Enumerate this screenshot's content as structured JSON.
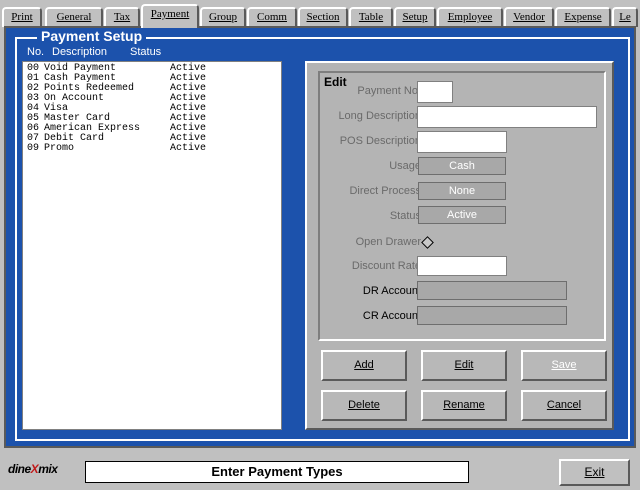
{
  "tabs": [
    {
      "label": "Print"
    },
    {
      "label": "General"
    },
    {
      "label": "Tax"
    },
    {
      "label": "Payment"
    },
    {
      "label": "Group"
    },
    {
      "label": "Comm"
    },
    {
      "label": "Section"
    },
    {
      "label": "Table"
    },
    {
      "label": "Setup"
    },
    {
      "label": "Employee"
    },
    {
      "label": "Vendor"
    },
    {
      "label": "Expense"
    },
    {
      "label": "Le"
    }
  ],
  "panel": {
    "title": "Payment Setup",
    "columns": {
      "no": "No.",
      "description": "Description",
      "status": "Status"
    }
  },
  "list": [
    {
      "no": "00",
      "description": "Void Payment",
      "status": "Active"
    },
    {
      "no": "01",
      "description": "Cash Payment",
      "status": "Active"
    },
    {
      "no": "02",
      "description": "Points Redeemed",
      "status": "Active"
    },
    {
      "no": "03",
      "description": "On Account",
      "status": "Active"
    },
    {
      "no": "04",
      "description": "Visa",
      "status": "Active"
    },
    {
      "no": "05",
      "description": "Master Card",
      "status": "Active"
    },
    {
      "no": "06",
      "description": "American Express",
      "status": "Active"
    },
    {
      "no": "07",
      "description": "Debit Card",
      "status": "Active"
    },
    {
      "no": "09",
      "description": "Promo",
      "status": "Active"
    }
  ],
  "edit": {
    "title": "Edit",
    "payment_no_label": "Payment No.",
    "payment_no_value": "",
    "long_desc_label": "Long Description",
    "long_desc_value": "",
    "pos_desc_label": "POS Description",
    "pos_desc_value": "",
    "usage_label": "Usage",
    "usage_value": "Cash",
    "direct_process_label": "Direct Process",
    "direct_process_value": "None",
    "status_label": "Status",
    "status_value": "Active",
    "open_drawer_label": "Open Drawer",
    "discount_rate_label": "Discount Rate",
    "discount_rate_value": "",
    "dr_account_label": "DR Account",
    "cr_account_label": "CR Account"
  },
  "buttons": {
    "add": "Add",
    "edit": "Edit",
    "save": "Save",
    "delete": "Delete",
    "rename": "Rename",
    "cancel": "Cancel"
  },
  "footer": {
    "logo_left": "dine",
    "logo_x": "X",
    "logo_right": "mix",
    "status": "Enter Payment Types",
    "exit": "Exit"
  },
  "colors": {
    "panel_blue": "#1c52ac",
    "chrome_grey": "#c0c0c0"
  }
}
